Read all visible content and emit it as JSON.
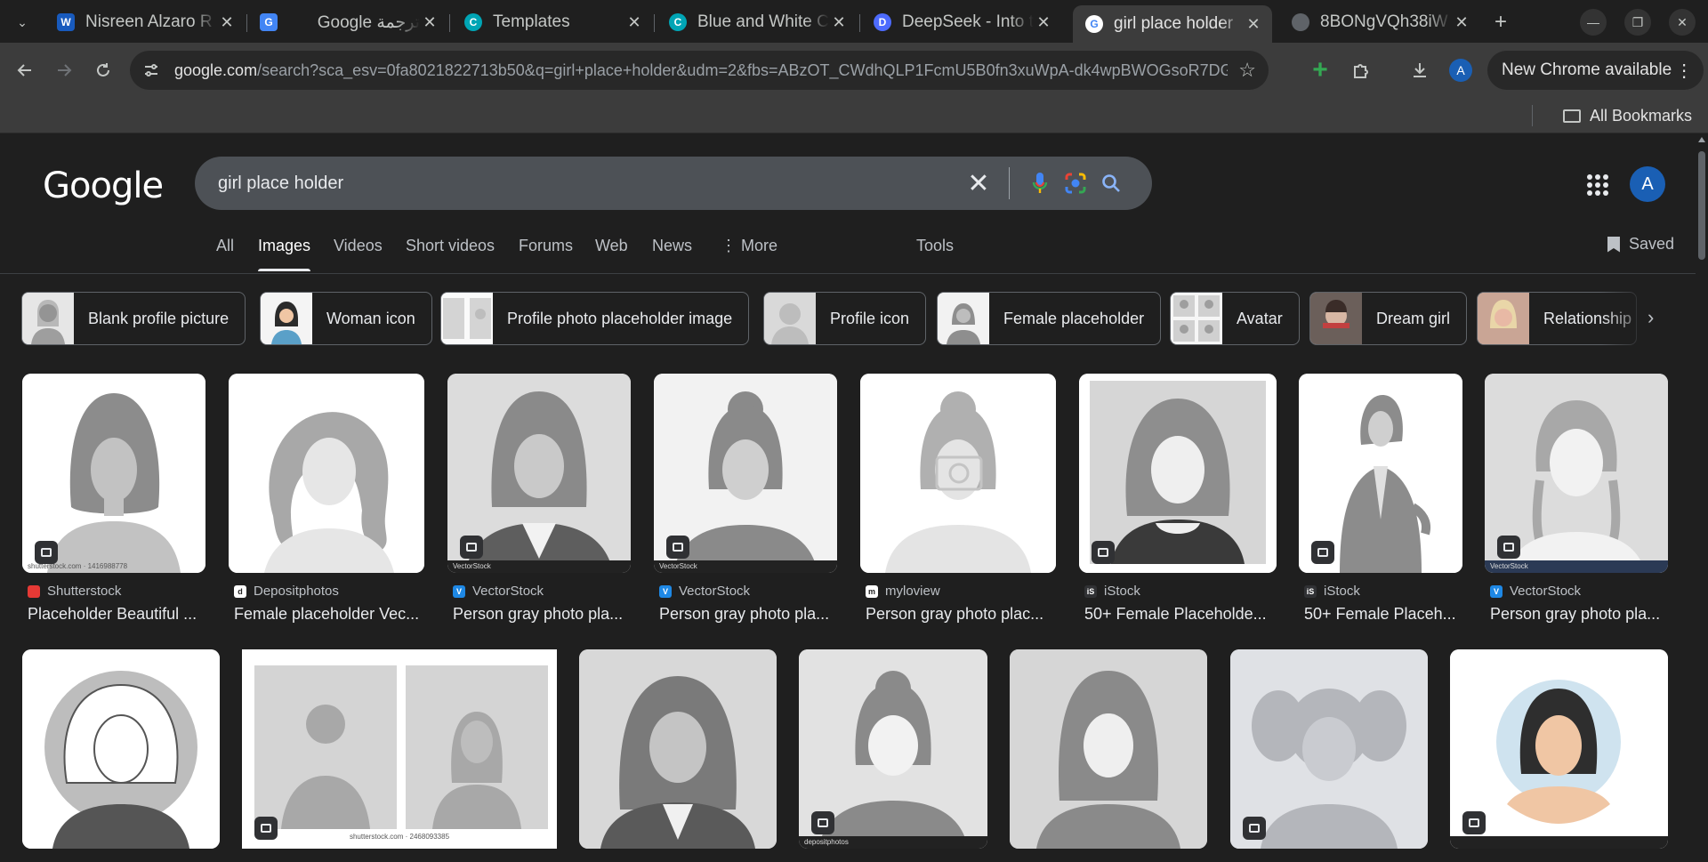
{
  "browser": {
    "tabs": [
      {
        "title": "Nisreen Alzaro R",
        "favicon": "word-icon",
        "fav_color": "#185abd",
        "fav_text": "W"
      },
      {
        "title": "Google ترجمة",
        "favicon": "translate-icon",
        "fav_color": "#4285f4",
        "fav_text": "G"
      },
      {
        "title": "Templates",
        "favicon": "canva-icon",
        "fav_color": "#00c4cc",
        "fav_text": "C"
      },
      {
        "title": "Blue and White C",
        "favicon": "canva-icon",
        "fav_color": "#00c4cc",
        "fav_text": "C"
      },
      {
        "title": "DeepSeek - Into t",
        "favicon": "deepseek-icon",
        "fav_color": "#4d6bfe",
        "fav_text": "D"
      },
      {
        "title": "girl place holder",
        "favicon": "google-icon",
        "fav_color": "#ffffff",
        "fav_text": "G",
        "active": true
      },
      {
        "title": "8BONgVQh38iW",
        "favicon": "globe-icon",
        "fav_color": "#5f6368",
        "fav_text": ""
      }
    ],
    "url_host": "google.com",
    "url_rest": "/search?sca_esv=0fa8021822713b50&q=girl+place+holder&udm=2&fbs=ABzOT_CWdhQLP1FcmU5B0fn3xuWpA-dk4wpBWOGsoR7DG5zJB...",
    "new_chrome_label": "New Chrome available",
    "profile_initial": "A",
    "all_bookmarks_label": "All Bookmarks"
  },
  "search": {
    "logo": "Google",
    "query": "girl place holder",
    "avatar_initial": "A",
    "nav_tabs": [
      "All",
      "Images",
      "Videos",
      "Short videos",
      "Forums",
      "Web",
      "News",
      "More",
      "Tools"
    ],
    "active_tab": "Images",
    "saved_label": "Saved"
  },
  "chips": [
    "Blank profile picture",
    "Woman icon",
    "Profile photo placeholder image",
    "Profile icon",
    "Female placeholder",
    "Avatar",
    "Dream girl",
    "Relationship"
  ],
  "results_row1": [
    {
      "source": "Shutterstock",
      "title": "Placeholder Beautiful ...",
      "src_color": "#e53935",
      "watermark": "shutterstock.com · 1416988778"
    },
    {
      "source": "Depositphotos",
      "title": "Female placeholder Vec...",
      "src_color": "#ffffff",
      "watermark": ""
    },
    {
      "source": "VectorStock",
      "title": "Person gray photo pla...",
      "src_color": "#1e88e5",
      "watermark": "VectorStock"
    },
    {
      "source": "VectorStock",
      "title": "Person gray photo pla...",
      "src_color": "#1e88e5",
      "watermark": "VectorStock"
    },
    {
      "source": "myloview",
      "title": "Person gray photo plac...",
      "src_color": "#ffffff",
      "watermark": ""
    },
    {
      "source": "iStock",
      "title": "50+ Female Placeholde...",
      "src_color": "#303134",
      "watermark": ""
    },
    {
      "source": "iStock",
      "title": "50+ Female Placeh...",
      "src_color": "#303134",
      "watermark": ""
    },
    {
      "source": "VectorStock",
      "title": "Person gray photo pla...",
      "src_color": "#1e88e5",
      "watermark": "VectorStock"
    }
  ],
  "results_row2_watermarks": [
    "",
    "shutterstock.com · 2468093385",
    "",
    "depositphotos",
    "",
    "",
    ""
  ]
}
